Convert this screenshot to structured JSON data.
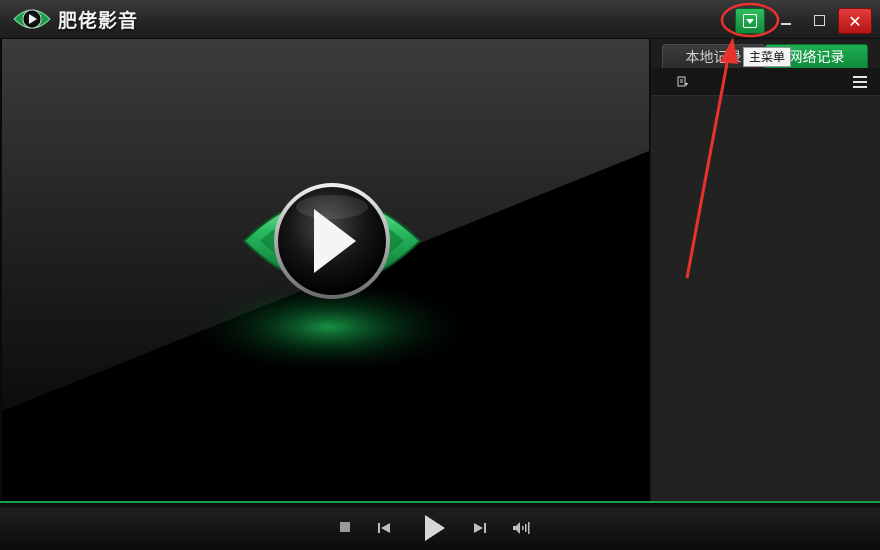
{
  "window": {
    "title": "肥佬影音",
    "buttons": {
      "main_menu_icon": "dropdown-menu-icon",
      "minimize_icon": "minimize-icon",
      "maximize_icon": "maximize-icon",
      "close_icon": "close-icon",
      "close_glyph": "✕"
    }
  },
  "tooltip": {
    "text": "主菜单"
  },
  "sidebar": {
    "tabs": [
      {
        "label": "本地记录",
        "active": false
      },
      {
        "label": "网络记录",
        "active": true
      }
    ]
  },
  "colors": {
    "accent_green": "#1aa04a",
    "close_red": "#d02020",
    "annotation_red": "#e8322c"
  },
  "controls": {
    "icons": [
      "stop-icon",
      "previous-icon",
      "play-icon",
      "next-icon",
      "volume-icon"
    ]
  }
}
